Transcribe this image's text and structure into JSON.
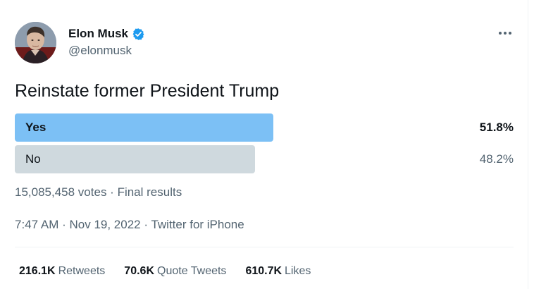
{
  "author": {
    "name": "Elon Musk",
    "handle": "@elonmusk",
    "verified": true
  },
  "tweet": {
    "text": "Reinstate former President Trump"
  },
  "poll": {
    "options": [
      {
        "label": "Yes",
        "percent": "51.8%",
        "winner": true
      },
      {
        "label": "No",
        "percent": "48.2%",
        "winner": false
      }
    ],
    "votes": "15,085,458 votes",
    "separator": " · ",
    "status": "Final results"
  },
  "meta": {
    "time": "7:47 AM",
    "date": "Nov 19, 2022",
    "source": "Twitter for iPhone",
    "separator": " · "
  },
  "stats": {
    "retweets": {
      "count": "216.1K",
      "label": "Retweets"
    },
    "quotes": {
      "count": "70.6K",
      "label": "Quote Tweets"
    },
    "likes": {
      "count": "610.7K",
      "label": "Likes"
    }
  },
  "colors": {
    "winner_bar": "#7cc0f5",
    "loser_bar": "#cfd9de",
    "verified_badge": "#1d9bf0",
    "secondary_text": "#536471"
  },
  "icons": {
    "verified": "verified-badge-icon",
    "more": "more-options-icon"
  }
}
